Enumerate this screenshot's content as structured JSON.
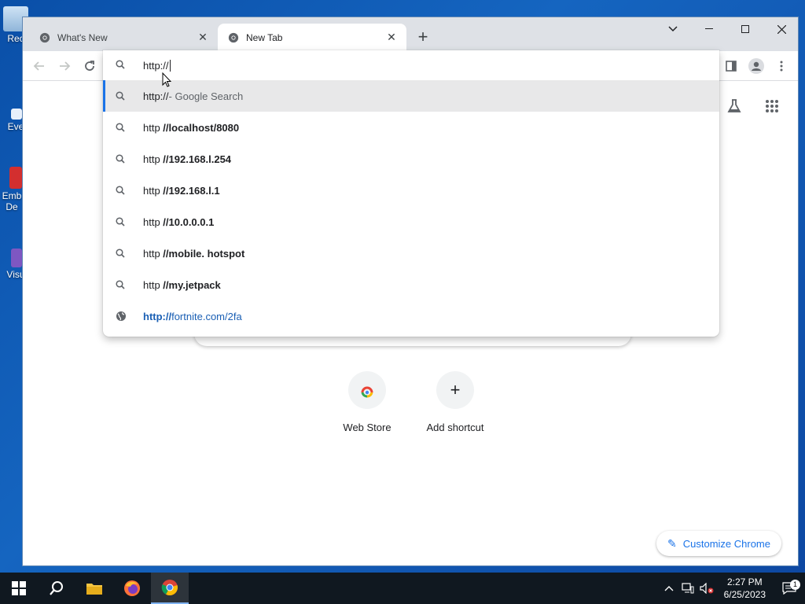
{
  "desktop": {
    "icons": [
      {
        "label": "Rec"
      },
      {
        "label": "Eve"
      },
      {
        "label": "Emb De"
      },
      {
        "label": "Visu"
      }
    ]
  },
  "tabs": [
    {
      "title": "What's New",
      "active": false
    },
    {
      "title": "New Tab",
      "active": true
    }
  ],
  "omnibox": {
    "value": "http://",
    "suggestions": [
      {
        "prefix": "http://",
        "rest": " - Google Search",
        "type": "search",
        "selected": true
      },
      {
        "prefix": "http ",
        "rest": "//localhost/8080",
        "type": "search"
      },
      {
        "prefix": "http ",
        "rest": "//192.168.l.254",
        "type": "search"
      },
      {
        "prefix": "http ",
        "rest": "//192.168.l.1",
        "type": "search"
      },
      {
        "prefix": "http ",
        "rest": "//10.0.0.0.1",
        "type": "search"
      },
      {
        "prefix": "http ",
        "rest": "//mobile. hotspot",
        "type": "search"
      },
      {
        "prefix": "http ",
        "rest": "//my.jetpack",
        "type": "search"
      },
      {
        "prefix": "http://",
        "rest": "fortnite.com/2fa",
        "type": "url"
      }
    ]
  },
  "shortcuts": [
    {
      "label": "Web Store"
    },
    {
      "label": "Add shortcut"
    }
  ],
  "customize_label": "Customize Chrome",
  "taskbar": {
    "time": "2:27 PM",
    "date": "6/25/2023",
    "notification_count": "1"
  },
  "colors": {
    "accent": "#1a73e8",
    "tabstrip": "#dee1e6",
    "taskbar": "#101820"
  }
}
